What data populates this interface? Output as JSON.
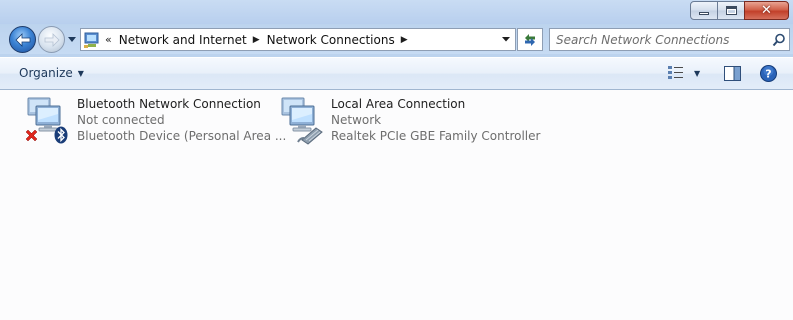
{
  "window": {
    "caption_buttons": [
      "minimize",
      "maximize",
      "close"
    ]
  },
  "address_bar": {
    "overflow_chevron": "«",
    "breadcrumbs": [
      {
        "label": "Network and Internet"
      },
      {
        "label": "Network Connections"
      }
    ]
  },
  "search": {
    "placeholder": "Search Network Connections"
  },
  "command_bar": {
    "organize_label": "Organize"
  },
  "connections": [
    {
      "name": "Bluetooth Network Connection",
      "status": "Not connected",
      "device": "Bluetooth Device (Personal Area ...",
      "icon": "bluetooth-network-icon",
      "badge": "disconnected-x-icon"
    },
    {
      "name": "Local Area Connection",
      "status": "Network",
      "device": "Realtek PCIe GBE Family Controller",
      "icon": "lan-network-icon"
    }
  ],
  "colors": {
    "frame": "#bcd3ee",
    "content_bg": "#fcfcfd",
    "secondary_text": "#6d6d6d",
    "close_button": "#c2402a"
  }
}
